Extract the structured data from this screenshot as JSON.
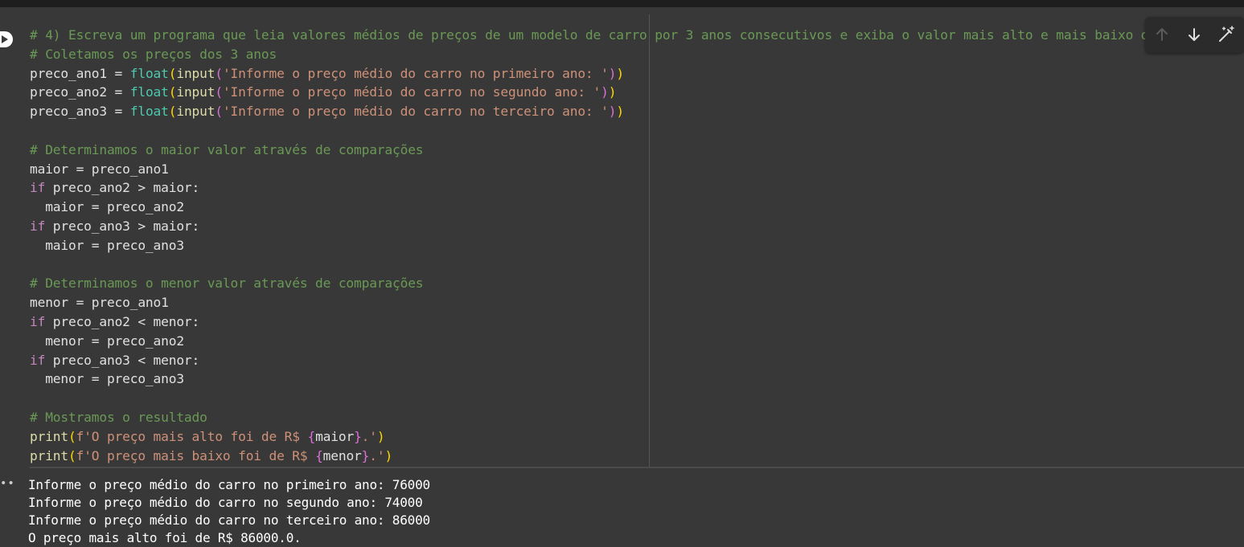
{
  "editor": {
    "code_lines": [
      "# 4) Escreva um programa que leia valores médios de preços de um modelo de carro por 3 anos consecutivos e exiba o valor mais alto e mais baixo d",
      "# Coletamos os preços dos 3 anos",
      "preco_ano1 = float(input('Informe o preço médio do carro no primeiro ano: '))",
      "preco_ano2 = float(input('Informe o preço médio do carro no segundo ano: '))",
      "preco_ano3 = float(input('Informe o preço médio do carro no terceiro ano: '))",
      "",
      "# Determinamos o maior valor através de comparações",
      "maior = preco_ano1",
      "if preco_ano2 > maior:",
      "  maior = preco_ano2",
      "if preco_ano3 > maior:",
      "  maior = preco_ano3",
      "",
      "# Determinamos o menor valor através de comparações",
      "menor = preco_ano1",
      "if preco_ano2 < menor:",
      "  menor = preco_ano2",
      "if preco_ano3 < menor:",
      "  menor = preco_ano3",
      "",
      "# Mostramos o resultado",
      "print(f'O preço mais alto foi de R$ {maior}.')",
      "print(f'O preço mais baixo foi de R$ {menor}.')"
    ]
  },
  "toolbar": {
    "icons": [
      "arrow-up-icon",
      "arrow-down-icon",
      "magic-wand-icon"
    ]
  },
  "output": {
    "lines": [
      "Informe o preço médio do carro no primeiro ano: 76000",
      "Informe o preço médio do carro no segundo ano: 74000",
      "Informe o preço médio do carro no terceiro ano: 86000",
      "O preço mais alto foi de R$ 86000.0."
    ]
  },
  "colors": {
    "background": "#383838",
    "comment": "#6a9955",
    "keyword": "#c586c0",
    "function": "#4ec9b0",
    "builtin": "#dcdcaa",
    "string": "#ce9178",
    "text": "#e0e0e0"
  }
}
